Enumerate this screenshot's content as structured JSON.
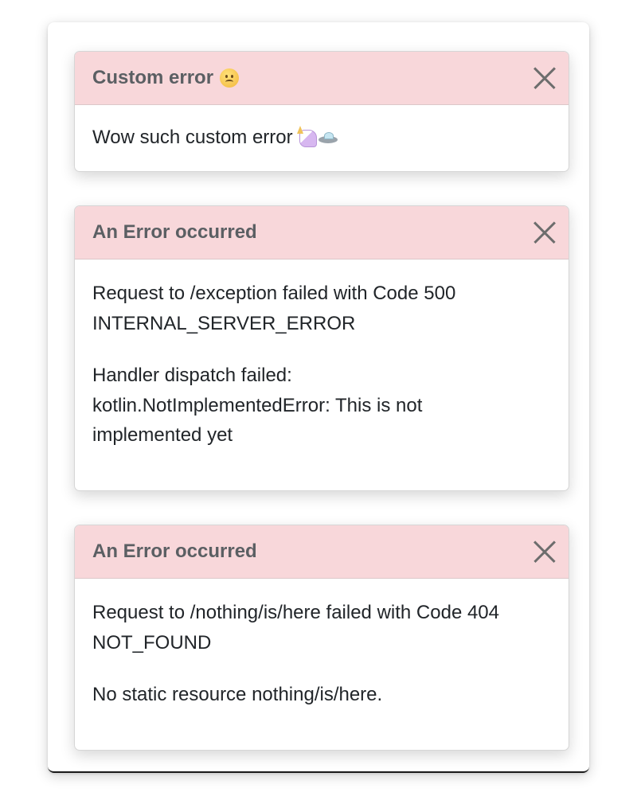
{
  "toasts": [
    {
      "title": "Custom error",
      "title_icon": "slightly-frowning-face-icon",
      "paragraphs": [
        "Wow such custom error"
      ],
      "body_icons": [
        "unicorn-icon",
        "flying-saucer-icon"
      ],
      "close_icon": "close-icon"
    },
    {
      "title": "An Error occurred",
      "paragraphs": [
        "Request to /exception failed with Code 500 INTERNAL_SERVER_ERROR",
        "Handler dispatch failed: kotlin.NotImplementedError: This is not implemented yet"
      ],
      "close_icon": "close-icon"
    },
    {
      "title": "An Error occurred",
      "paragraphs": [
        "Request to /nothing/is/here failed with Code 404 NOT_FOUND",
        "No static resource nothing/is/here."
      ],
      "close_icon": "close-icon"
    }
  ],
  "colors": {
    "header_bg": "#f8d7da",
    "title_text": "#5b5f63",
    "body_text": "#212529",
    "close_icon": "#6d6d6d"
  }
}
